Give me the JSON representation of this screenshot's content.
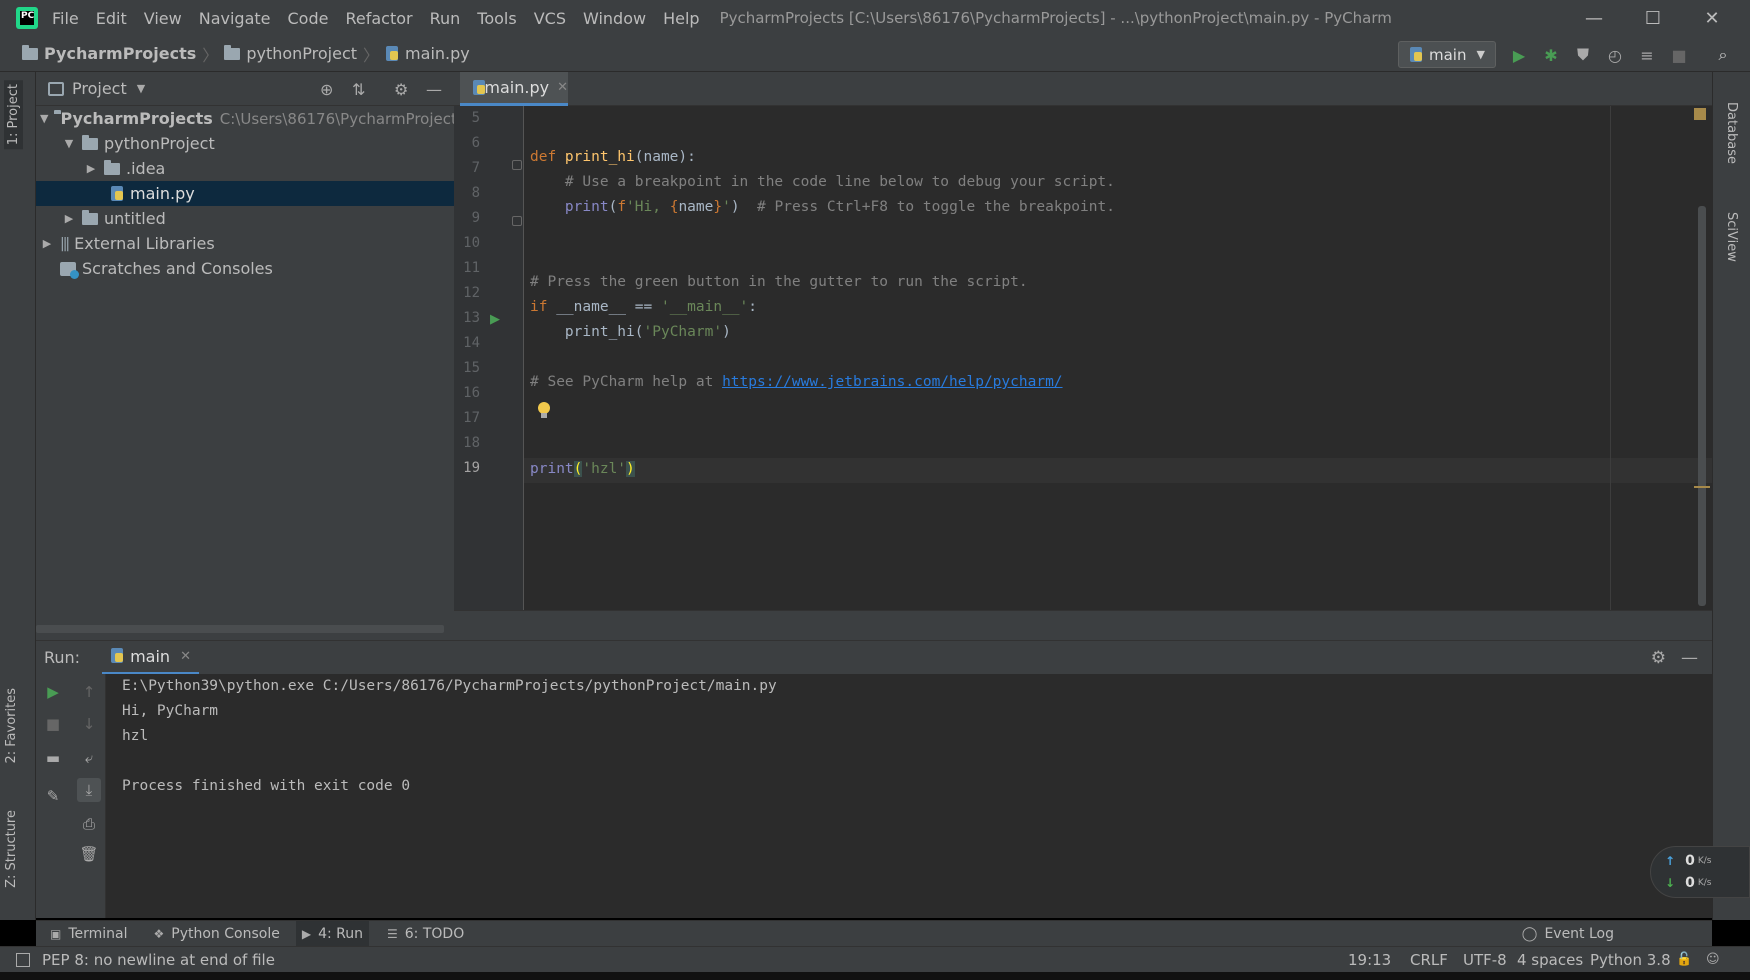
{
  "titlebar": {
    "app_logo": "PC",
    "menu": [
      "File",
      "Edit",
      "View",
      "Navigate",
      "Code",
      "Refactor",
      "Run",
      "Tools",
      "VCS",
      "Window",
      "Help"
    ],
    "window_title": "PycharmProjects [C:\\Users\\86176\\PycharmProjects] - ...\\pythonProject\\main.py - PyCharm",
    "controls": {
      "minimize": "—",
      "maximize": "☐",
      "close": "✕"
    }
  },
  "navbar": {
    "breadcrumbs": [
      "PycharmProjects",
      "pythonProject",
      "main.py"
    ],
    "run_config": "main"
  },
  "left_stripe": {
    "project_tab": "1: Project",
    "favorites_tab": "2: Favorites",
    "structure_tab": "Z: Structure"
  },
  "right_stripe": {
    "database_tab": "Database",
    "sciview_tab": "SciView"
  },
  "project_panel": {
    "title": "Project",
    "tree": [
      {
        "label": "PycharmProjects",
        "path": "C:\\Users\\86176\\PycharmProjects",
        "level": 0,
        "expanded": true,
        "kind": "folder"
      },
      {
        "label": "pythonProject",
        "level": 1,
        "expanded": true,
        "kind": "folder"
      },
      {
        "label": ".idea",
        "level": 2,
        "expanded": false,
        "kind": "folder"
      },
      {
        "label": "main.py",
        "level": 2,
        "kind": "python",
        "selected": true
      },
      {
        "label": "untitled",
        "level": 1,
        "expanded": false,
        "kind": "folder"
      },
      {
        "label": "External Libraries",
        "level": 0,
        "expanded": false,
        "kind": "library"
      },
      {
        "label": "Scratches and Consoles",
        "level": 0,
        "kind": "scratch"
      }
    ]
  },
  "editor": {
    "tab_label": "main.py",
    "line_numbers": [
      "5",
      "6",
      "7",
      "8",
      "9",
      "10",
      "11",
      "12",
      "13",
      "14",
      "15",
      "16",
      "17",
      "18",
      "19"
    ],
    "current_line": "19",
    "code": {
      "l7_kw": "def ",
      "l7_fn": "print_hi",
      "l7_rest": "(name):",
      "l8": "    # Use a breakpoint in the code line below to debug your script.",
      "l9_indent": "    ",
      "l9_print": "print",
      "l9_open": "(",
      "l9_f": "f",
      "l9_str1": "'Hi, ",
      "l9_brace_open": "{",
      "l9_name": "name",
      "l9_brace_close": "}",
      "l9_str2": "'",
      "l9_close": ")",
      "l9_comment": "  # Press Ctrl+F8 to toggle the breakpoint.",
      "l12": "# Press the green button in the gutter to run the script.",
      "l13_kw": "if ",
      "l13_name": "__name__",
      "l13_eq": " == ",
      "l13_str": "'__main__'",
      "l13_colon": ":",
      "l14_call": "    print_hi(",
      "l14_str": "'PyCharm'",
      "l14_close": ")",
      "l16_comment": "# See PyCharm help at ",
      "l16_link": "https://www.jetbrains.com/help/pycharm/",
      "l19_print": "print",
      "l19_open": "(",
      "l19_str": "'hzl'",
      "l19_close": ")"
    }
  },
  "run_panel": {
    "label": "Run:",
    "tab": "main",
    "output": [
      "E:\\Python39\\python.exe C:/Users/86176/PycharmProjects/pythonProject/main.py",
      "Hi, PyCharm",
      "hzl",
      "",
      "Process finished with exit code 0"
    ]
  },
  "net_widget": {
    "up": "0",
    "down": "0",
    "unit": "K/s"
  },
  "bottom_tabs": [
    {
      "icon": "terminal-icon",
      "label": "Terminal"
    },
    {
      "icon": "python-console-icon",
      "label": "Python Console"
    },
    {
      "icon": "run-icon",
      "label": "4: Run"
    },
    {
      "icon": "todo-icon",
      "label": "6: TODO"
    }
  ],
  "event_log": "Event Log",
  "statusbar": {
    "message": "PEP 8: no newline at end of file",
    "position": "19:13",
    "line_sep": "CRLF",
    "encoding": "UTF-8",
    "indent": "4 spaces",
    "interpreter": "Python 3.8"
  }
}
